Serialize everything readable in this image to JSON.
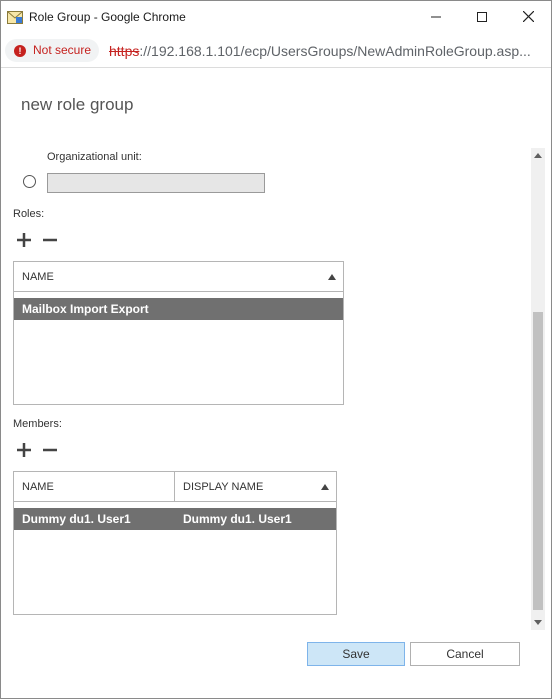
{
  "window": {
    "title": "Role Group - Google Chrome"
  },
  "address_bar": {
    "security_text": "Not secure",
    "url_scheme": "https",
    "url_rest": "://192.168.1.101/ecp/UsersGroups/NewAdminRoleGroup.asp..."
  },
  "page": {
    "title": "new role group"
  },
  "org_unit": {
    "label": "Organizational unit:",
    "value": ""
  },
  "roles": {
    "label": "Roles:",
    "columns": [
      "NAME"
    ],
    "rows": [
      {
        "name": "Mailbox Import Export",
        "selected": true
      }
    ]
  },
  "members": {
    "label": "Members:",
    "columns": [
      "NAME",
      "DISPLAY NAME"
    ],
    "rows": [
      {
        "name": "Dummy du1. User1",
        "display_name": "Dummy du1. User1",
        "selected": true
      }
    ]
  },
  "footer": {
    "save_label": "Save",
    "cancel_label": "Cancel"
  },
  "icons": {
    "app": "mail-envelope-icon",
    "minimize": "minimize-icon",
    "maximize": "maximize-icon",
    "close": "close-icon",
    "security": "not-secure-icon",
    "add": "plus-icon",
    "remove": "minus-icon"
  },
  "colors": {
    "selected_row": "#707070",
    "not_secure": "#c5221f",
    "save_button": "#cde6f7"
  }
}
